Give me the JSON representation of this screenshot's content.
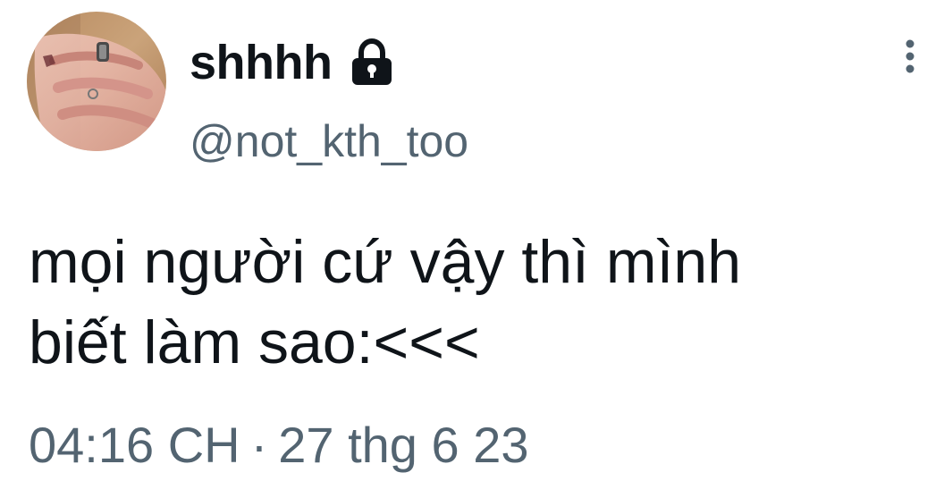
{
  "author": {
    "display_name": "shhhh",
    "handle": "@not_kth_too",
    "avatar_icon": "hand-photo-avatar",
    "protected_icon": "lock-icon"
  },
  "header": {
    "more_icon": "more-vertical-icon"
  },
  "tweet": {
    "text": "mọi người cứ vậy thì mình\nbiết làm sao:<<<",
    "time": "04:16 CH",
    "separator": "·",
    "date": "27 thg 6 23"
  },
  "colors": {
    "text_primary": "#0f1419",
    "text_secondary": "#536471",
    "background": "#ffffff"
  }
}
